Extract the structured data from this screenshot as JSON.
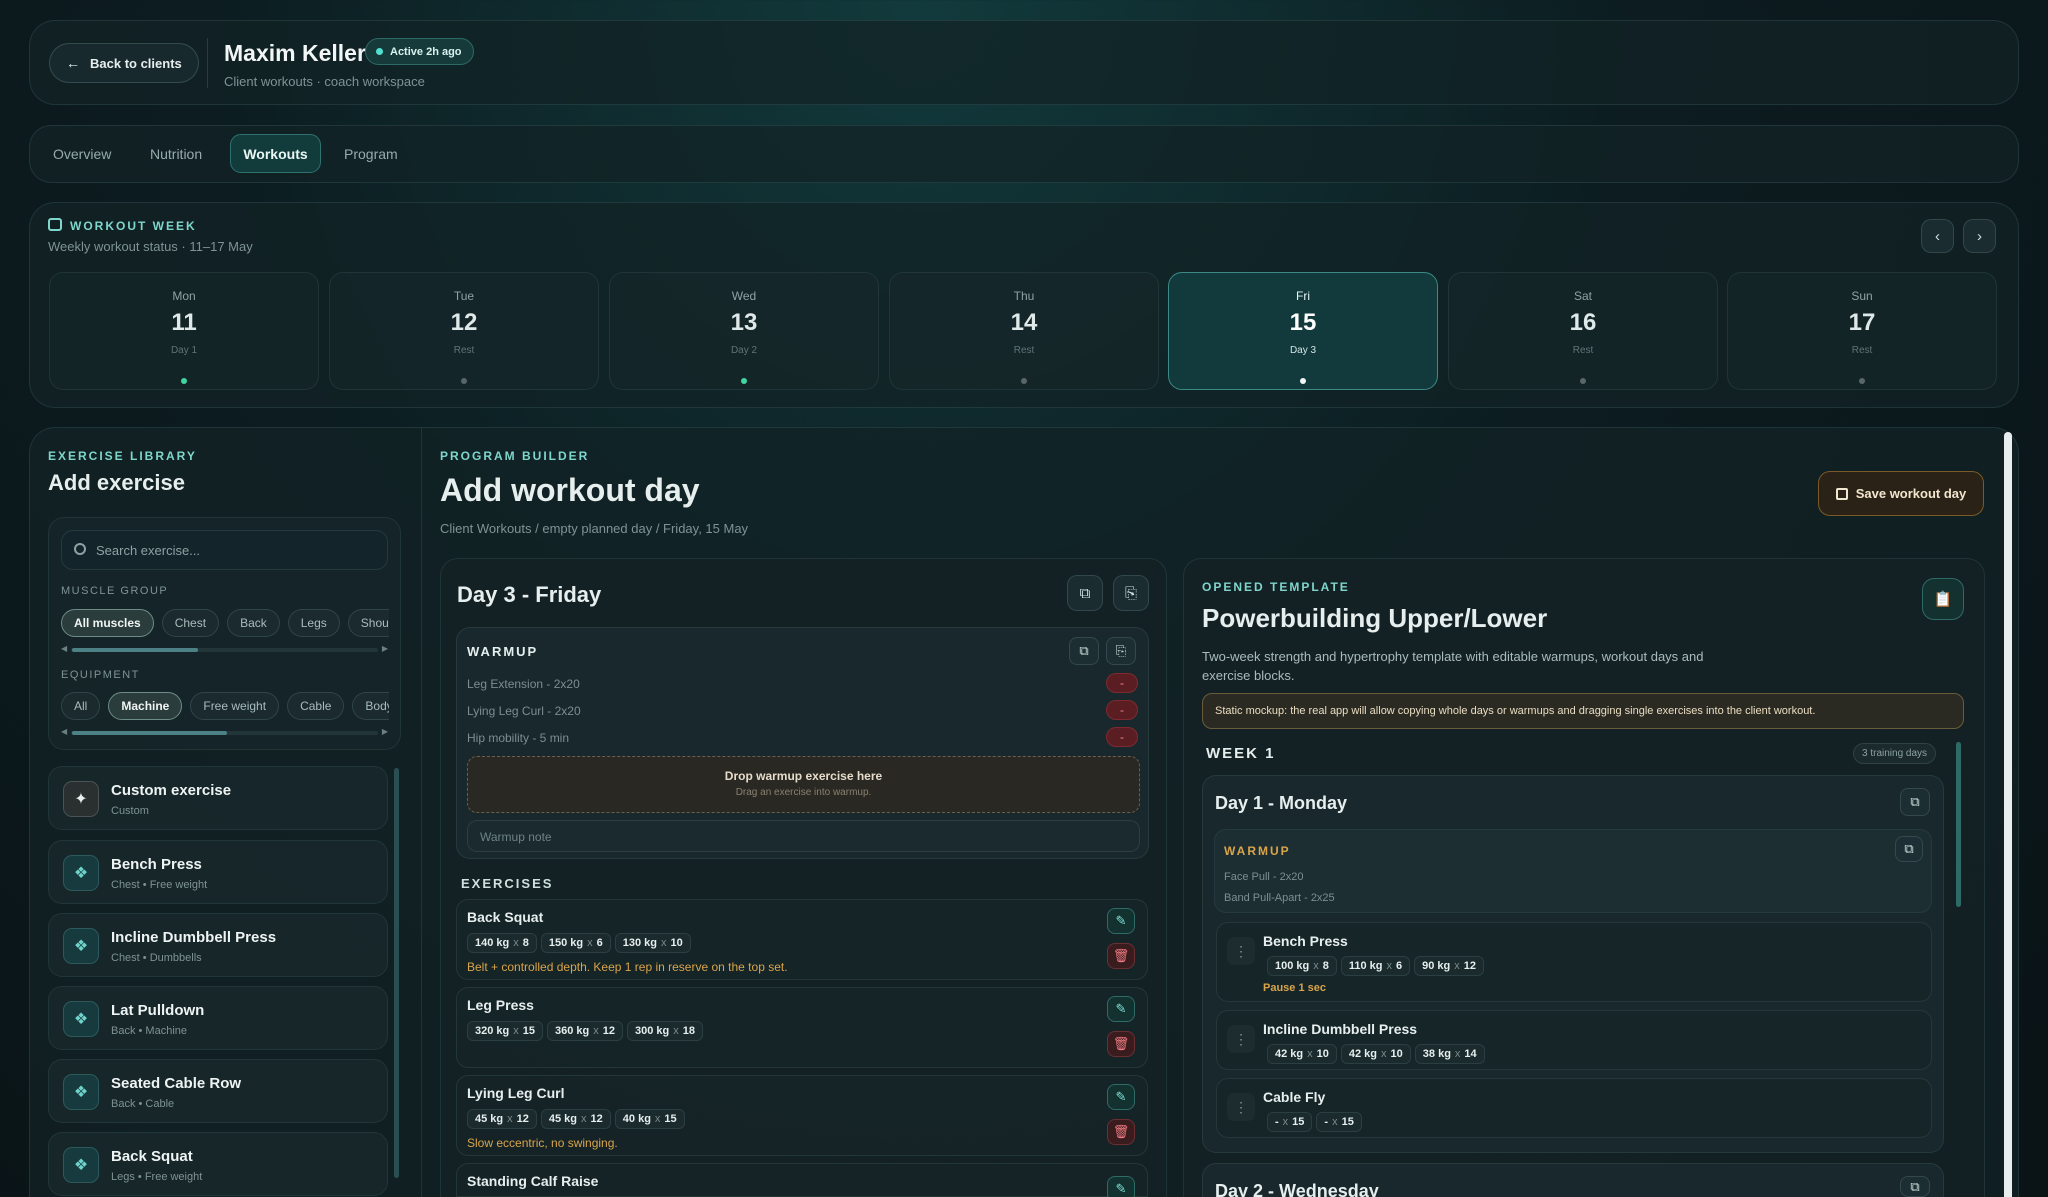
{
  "header": {
    "back_label": "Back to clients",
    "client_name": "Maxim Keller",
    "status": "Active 2h ago",
    "subtitle": "Client workouts · coach workspace"
  },
  "tabs": [
    {
      "label": "Overview"
    },
    {
      "label": "Nutrition"
    },
    {
      "label": "Workouts"
    },
    {
      "label": "Program"
    }
  ],
  "active_tab": "Workouts",
  "week": {
    "title": "WORKOUT WEEK",
    "subtitle": "Weekly workout status · 11–17 May",
    "days": [
      {
        "dow": "Mon",
        "num": "11",
        "label": "Day 1",
        "status": "done"
      },
      {
        "dow": "Tue",
        "num": "12",
        "label": "Rest",
        "status": "rest"
      },
      {
        "dow": "Wed",
        "num": "13",
        "label": "Day 2",
        "status": "done"
      },
      {
        "dow": "Thu",
        "num": "14",
        "label": "Rest",
        "status": "rest"
      },
      {
        "dow": "Fri",
        "num": "15",
        "label": "Day 3",
        "status": "selected"
      },
      {
        "dow": "Sat",
        "num": "16",
        "label": "Rest",
        "status": "rest"
      },
      {
        "dow": "Sun",
        "num": "17",
        "label": "Rest",
        "status": "rest"
      }
    ]
  },
  "library": {
    "label": "EXERCISE LIBRARY",
    "title": "Add exercise",
    "search_placeholder": "Search exercise...",
    "muscle_group_label": "MUSCLE GROUP",
    "muscle_groups": [
      "All muscles",
      "Chest",
      "Back",
      "Legs",
      "Shoulders"
    ],
    "equipment_label": "EQUIPMENT",
    "equipment": [
      "All",
      "Machine",
      "Free weight",
      "Cable",
      "Bodywe"
    ],
    "items": [
      {
        "name": "Custom exercise",
        "sub": "Custom",
        "icon": "sparkle-icon"
      },
      {
        "name": "Bench Press",
        "sub": "Chest • Free weight",
        "icon": "dumbbell-icon"
      },
      {
        "name": "Incline Dumbbell Press",
        "sub": "Chest • Dumbbells",
        "icon": "dumbbell-icon"
      },
      {
        "name": "Lat Pulldown",
        "sub": "Back • Machine",
        "icon": "dumbbell-icon"
      },
      {
        "name": "Seated Cable Row",
        "sub": "Back • Cable",
        "icon": "dumbbell-icon"
      },
      {
        "name": "Back Squat",
        "sub": "Legs • Free weight",
        "icon": "dumbbell-icon"
      }
    ]
  },
  "builder": {
    "label": "PROGRAM BUILDER",
    "title": "Add workout day",
    "breadcrumb": "Client Workouts / empty planned day / Friday, 15 May",
    "save_label": "Save workout day",
    "day_title": "Day 3 - Friday",
    "warmup_label": "WARMUP",
    "warmup_items": [
      "Leg Extension - 2x20",
      "Lying Leg Curl - 2x20",
      "Hip mobility - 5 min"
    ],
    "drop_title": "Drop warmup exercise here",
    "drop_sub": "Drag an exercise into warmup.",
    "warmup_note_placeholder": "Warmup note",
    "exercises_label": "EXERCISES",
    "exercises": [
      {
        "name": "Back Squat",
        "sets": [
          [
            "140 kg",
            "8"
          ],
          [
            "150 kg",
            "6"
          ],
          [
            "130 kg",
            "10"
          ]
        ],
        "note": "Belt + controlled depth. Keep 1 rep in reserve on the top set."
      },
      {
        "name": "Leg Press",
        "sets": [
          [
            "320 kg",
            "15"
          ],
          [
            "360 kg",
            "12"
          ],
          [
            "300 kg",
            "18"
          ]
        ],
        "note": ""
      },
      {
        "name": "Lying Leg Curl",
        "sets": [
          [
            "45 kg",
            "12"
          ],
          [
            "45 kg",
            "12"
          ],
          [
            "40 kg",
            "15"
          ]
        ],
        "note": "Slow eccentric, no swinging."
      },
      {
        "name": "Standing Calf Raise",
        "sets": [],
        "note": ""
      }
    ]
  },
  "template": {
    "label": "OPENED TEMPLATE",
    "title": "Powerbuilding Upper/Lower",
    "description": "Two-week strength and hypertrophy template with editable warmups, workout days and exercise blocks.",
    "notice": "Static mockup: the real app will allow copying whole days or warmups and dragging single exercises into the client workout.",
    "week_label": "WEEK 1",
    "week_badge": "3 training days",
    "day1_title": "Day 1 - Monday",
    "warmup_label": "WARMUP",
    "warmup_items": [
      "Face Pull - 2x20",
      "Band Pull-Apart - 2x25"
    ],
    "exercises": [
      {
        "name": "Bench Press",
        "sets": [
          [
            "100 kg",
            "8"
          ],
          [
            "110 kg",
            "6"
          ],
          [
            "90 kg",
            "12"
          ]
        ],
        "note": "Pause 1 sec"
      },
      {
        "name": "Incline Dumbbell Press",
        "sets": [
          [
            "42 kg",
            "10"
          ],
          [
            "42 kg",
            "10"
          ],
          [
            "38 kg",
            "14"
          ]
        ],
        "note": ""
      },
      {
        "name": "Cable Fly",
        "sets": [
          [
            "-",
            "15"
          ],
          [
            "-",
            "15"
          ]
        ],
        "note": ""
      }
    ],
    "day2_title": "Day 2 - Wednesday"
  },
  "colors": {
    "accent": "#5fd6cb",
    "warning": "#d9a44a",
    "danger": "#ef7d83"
  }
}
